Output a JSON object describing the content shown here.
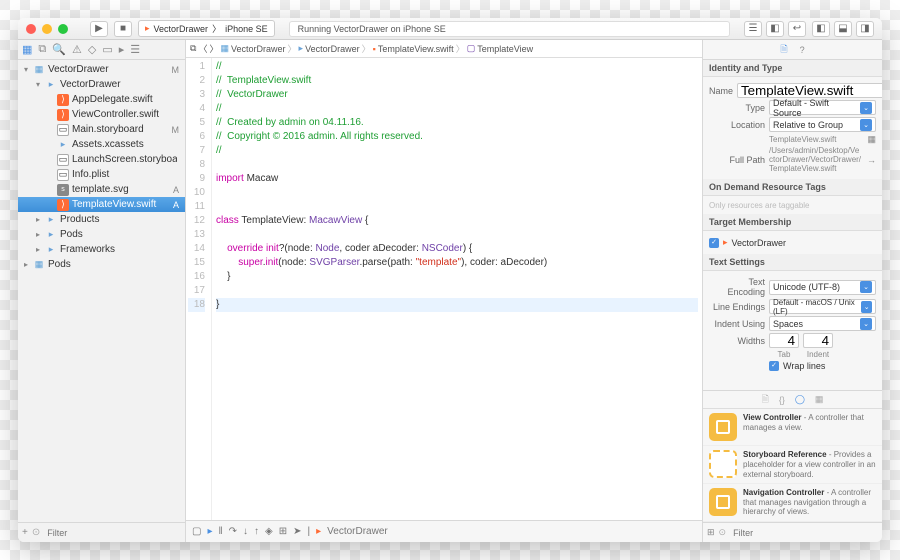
{
  "scheme": {
    "target": "VectorDrawer",
    "device": "iPhone SE"
  },
  "status": "Running VectorDrawer on iPhone SE",
  "tree": [
    {
      "depth": 0,
      "disc": "▾",
      "icon": "proj",
      "name": "VectorDrawer",
      "status": "M"
    },
    {
      "depth": 1,
      "disc": "▾",
      "icon": "fold",
      "name": "VectorDrawer",
      "status": ""
    },
    {
      "depth": 2,
      "disc": "",
      "icon": "swift",
      "name": "AppDelegate.swift",
      "status": ""
    },
    {
      "depth": 2,
      "disc": "",
      "icon": "swift",
      "name": "ViewController.swift",
      "status": ""
    },
    {
      "depth": 2,
      "disc": "",
      "icon": "sb",
      "name": "Main.storyboard",
      "status": "M"
    },
    {
      "depth": 2,
      "disc": "",
      "icon": "fold",
      "name": "Assets.xcassets",
      "status": ""
    },
    {
      "depth": 2,
      "disc": "",
      "icon": "sb",
      "name": "LaunchScreen.storyboard",
      "status": ""
    },
    {
      "depth": 2,
      "disc": "",
      "icon": "sb",
      "name": "Info.plist",
      "status": ""
    },
    {
      "depth": 2,
      "disc": "",
      "icon": "svg",
      "name": "template.svg",
      "status": "A"
    },
    {
      "depth": 2,
      "disc": "",
      "icon": "swift",
      "name": "TemplateView.swift",
      "status": "A",
      "sel": true
    },
    {
      "depth": 1,
      "disc": "▸",
      "icon": "fold",
      "name": "Products",
      "status": ""
    },
    {
      "depth": 1,
      "disc": "▸",
      "icon": "fold",
      "name": "Pods",
      "status": ""
    },
    {
      "depth": 1,
      "disc": "▸",
      "icon": "fold",
      "name": "Frameworks",
      "status": ""
    },
    {
      "depth": 0,
      "disc": "▸",
      "icon": "proj",
      "name": "Pods",
      "status": ""
    }
  ],
  "nav_filter": "Filter",
  "jump": [
    "VectorDrawer",
    "VectorDrawer",
    "TemplateView.swift",
    "TemplateView"
  ],
  "code": {
    "c1": "//",
    "c2": "//  TemplateView.swift",
    "c3": "//  VectorDrawer",
    "c4": "//",
    "c5": "//  Created by admin on 04.11.16.",
    "c6": "//  Copyright © 2016 admin. All rights reserved.",
    "c7": "//",
    "imp": "import",
    "impM": " Macaw",
    "cls1": "class",
    "cls2": " TemplateView: ",
    "cls3": "MacawView",
    "cls4": " {",
    "ov1": "    override",
    "ov2": " init",
    "ov3": "?(node: ",
    "ov4": "Node",
    "ov5": ", coder aDecoder: ",
    "ov6": "NSCoder",
    "ov7": ") {",
    "sp1": "        super",
    "sp2": ".",
    "sp3": "init",
    "sp4": "(node: ",
    "sp5": "SVGParser",
    "sp6": ".parse(path: ",
    "sp7": "\"template\"",
    "sp8": "), coder: aDecoder)",
    "cb1": "    }",
    "cb2": "}"
  },
  "debug_target": "VectorDrawer",
  "identity": {
    "name_label": "Name",
    "name_value": "TemplateView.swift",
    "type_label": "Type",
    "type_value": "Default - Swift Source",
    "loc_label": "Location",
    "loc_value": "Relative to Group",
    "loc_file": "TemplateView.swift",
    "fp_label": "Full Path",
    "fp_value": "/Users/admin/Desktop/VectorDrawer/VectorDrawer/TemplateView.swift"
  },
  "sections": {
    "identity": "Identity and Type",
    "ondemand": "On Demand Resource Tags",
    "ondemand_ph": "Only resources are taggable",
    "target": "Target Membership",
    "target_item": "VectorDrawer",
    "text": "Text Settings"
  },
  "text_settings": {
    "enc_l": "Text Encoding",
    "enc_v": "Unicode (UTF-8)",
    "le_l": "Line Endings",
    "le_v": "Default - macOS / Unix (LF)",
    "iu_l": "Indent Using",
    "iu_v": "Spaces",
    "w_l": "Widths",
    "w_tab": "4",
    "w_ind": "4",
    "tab_l": "Tab",
    "ind_l": "Indent",
    "wrap": "Wrap lines"
  },
  "library": [
    {
      "cls": "y1",
      "title": "View Controller",
      "desc": " - A controller that manages a view."
    },
    {
      "cls": "y2",
      "title": "Storyboard Reference",
      "desc": " - Provides a placeholder for a view controller in an external storyboard."
    },
    {
      "cls": "y1",
      "title": "Navigation Controller",
      "desc": " - A controller that manages navigation through a hierarchy of views."
    }
  ],
  "lib_filter": "Filter"
}
